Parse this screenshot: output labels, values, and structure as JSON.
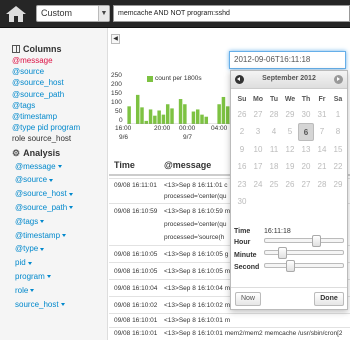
{
  "topbar": {
    "time_select": "Custom",
    "query": "memcache AND NOT program:sshd"
  },
  "sidebar": {
    "columns_title": "Columns",
    "columns": [
      "@message",
      "@source",
      "@source_host",
      "@source_path",
      "@tags",
      "@timestamp",
      "@type pid program",
      "role source_host"
    ],
    "analysis_title": "Analysis",
    "analysis": [
      "@message",
      "@source",
      "@source_host",
      "@source_path",
      "@tags",
      "@timestamp",
      "@type",
      "pid",
      "program",
      "role",
      "source_host"
    ]
  },
  "chart_data": {
    "type": "bar",
    "legend": "count per 1800s",
    "y_ticks": [
      "250",
      "200",
      "150",
      "100",
      "50",
      "0"
    ],
    "ylim": [
      0,
      250
    ],
    "x_ticks": [
      {
        "time": "16:00",
        "date": "9/6"
      },
      {
        "time": "20:00",
        "date": ""
      },
      {
        "time": "00:00",
        "date": "9/7"
      },
      {
        "time": "04:00",
        "date": ""
      }
    ],
    "values": [
      85,
      0,
      140,
      80,
      15,
      70,
      40,
      65,
      45,
      95,
      75,
      0,
      120,
      95,
      0,
      60,
      70,
      45,
      35,
      0,
      0,
      95,
      130,
      85,
      15,
      60,
      55,
      70
    ]
  },
  "results": {
    "col_time": "Time",
    "col_message": "@message",
    "rows": [
      {
        "time": "09/08 16:11:01",
        "lines": [
          "<13>Sep 8 16:11:01 c",
          "processed='center(qu"
        ]
      },
      {
        "time": "09/08 16:10:59",
        "lines": [
          "<13>Sep 8 16:10:59 m",
          "processed='center(qu",
          "processed='source(h"
        ]
      },
      {
        "time": "09/08 16:10:05",
        "lines": [
          "<13>Sep 8 16:10:05 g"
        ]
      },
      {
        "time": "09/08 16:10:05",
        "lines": [
          "<13>Sep 8 16:10:05 m"
        ]
      },
      {
        "time": "09/08 16:10:04",
        "lines": [
          "<13>Sep 8 16:10:04 m"
        ]
      },
      {
        "time": "09/08 16:10:02",
        "lines": [
          "<13>Sep 8 16:10:02 m"
        ]
      },
      {
        "time": "09/08 16:10:01",
        "lines": [
          "<13>Sep 8 16:10:01 m"
        ]
      },
      {
        "time": "09/08 16:10:01",
        "lines": [
          "<13>Sep 8 16:10:01 mem2/mem2 memcache /usr/sbin/cron[2"
        ]
      }
    ]
  },
  "datepicker": {
    "value": "2012-09-06T16:11:18",
    "month_title": "September 2012",
    "dow": [
      "Su",
      "Mo",
      "Tu",
      "We",
      "Th",
      "Fr",
      "Sa"
    ],
    "weeks": [
      [
        "26",
        "27",
        "28",
        "29",
        "30",
        "31",
        "1"
      ],
      [
        "2",
        "3",
        "4",
        "5",
        "6",
        "7",
        "8"
      ],
      [
        "9",
        "10",
        "11",
        "12",
        "13",
        "14",
        "15"
      ],
      [
        "16",
        "17",
        "18",
        "19",
        "20",
        "21",
        "22"
      ],
      [
        "23",
        "24",
        "25",
        "26",
        "27",
        "28",
        "29"
      ],
      [
        "30",
        "",
        "",
        "",
        "",
        "",
        ""
      ]
    ],
    "selected_day": "6",
    "time_label": "Time",
    "time_value": "16:11:18",
    "hour_label": "Hour",
    "minute_label": "Minute",
    "second_label": "Second",
    "hour_level": 0.67,
    "minute_level": 0.18,
    "second_level": 0.3,
    "now_label": "Now",
    "done_label": "Done"
  }
}
